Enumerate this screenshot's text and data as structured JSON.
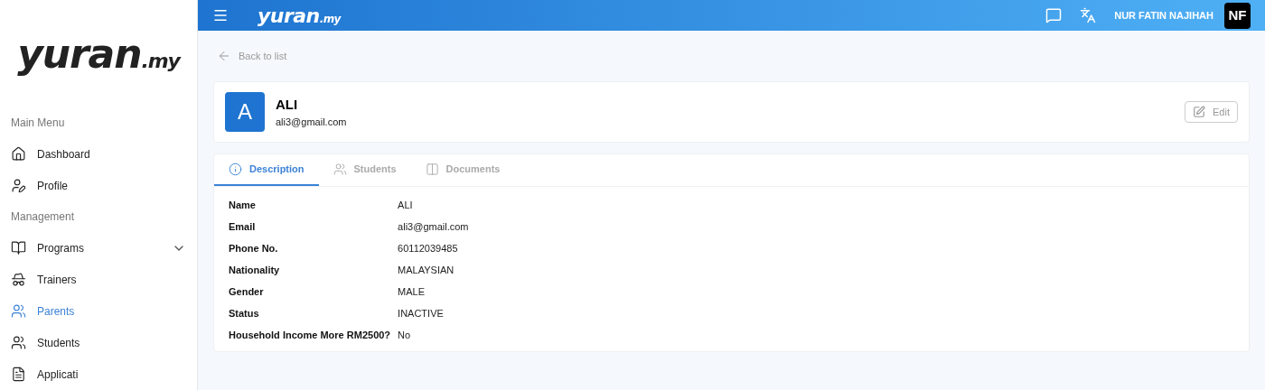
{
  "sidebar": {
    "logo": {
      "text": "yuran",
      "suffix": ".my"
    },
    "sections": [
      {
        "title": "Main Menu",
        "items": [
          {
            "label": "Dashboard",
            "selected": false,
            "expandable": false
          },
          {
            "label": "Profile",
            "selected": false,
            "expandable": false
          }
        ]
      },
      {
        "title": "Management",
        "items": [
          {
            "label": "Programs",
            "selected": false,
            "expandable": true
          },
          {
            "label": "Trainers",
            "selected": false,
            "expandable": false
          },
          {
            "label": "Parents",
            "selected": true,
            "expandable": false
          },
          {
            "label": "Students",
            "selected": false,
            "expandable": false
          },
          {
            "label": "Applicati",
            "selected": false,
            "expandable": false
          }
        ]
      }
    ]
  },
  "topbar": {
    "logo": {
      "text": "yuran",
      "suffix": ".my"
    },
    "user": "NUR FATIN NAJIHAH",
    "avatar": "NF"
  },
  "back_link": "Back to list",
  "profile": {
    "initial": "A",
    "name": "ALI",
    "email": "ali3@gmail.com",
    "edit_button": "Edit"
  },
  "tabs": [
    {
      "label": "Description",
      "selected": true
    },
    {
      "label": "Students",
      "selected": false
    },
    {
      "label": "Documents",
      "selected": false
    }
  ],
  "details": [
    {
      "label": "Name",
      "value": "ALI"
    },
    {
      "label": "Email",
      "value": "ali3@gmail.com"
    },
    {
      "label": "Phone No.",
      "value": "60112039485"
    },
    {
      "label": "Nationality",
      "value": "MALAYSIAN"
    },
    {
      "label": "Gender",
      "value": "MALE"
    },
    {
      "label": "Status",
      "value": "INACTIVE"
    },
    {
      "label": "Household Income More RM2500?",
      "value": "No"
    }
  ]
}
